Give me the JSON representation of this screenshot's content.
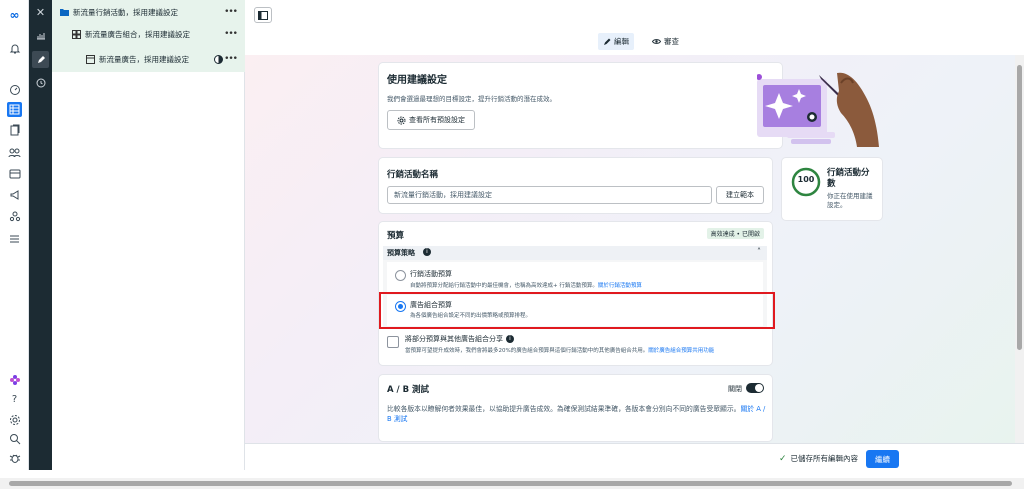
{
  "rail": {
    "icons": [
      "meta-logo-icon",
      "bell-icon",
      "gauge-icon",
      "table-icon",
      "pages-icon",
      "people-icon",
      "card-icon",
      "megaphone-icon",
      "audience-icon",
      "menu-icon",
      "flower-icon",
      "help-icon",
      "settings-icon",
      "search-icon",
      "bug-icon"
    ],
    "help_glyph": "?"
  },
  "tree": {
    "campaign": "新流量行銷活動，採用建議設定",
    "adset": "新流量廣告組合，採用建議設定",
    "ad": "新流量廣告，採用建議設定",
    "more": "•••"
  },
  "header": {
    "edit_label": "編輯",
    "review_label": "審查"
  },
  "recommend": {
    "title": "使用建議設定",
    "desc": "我們會選過最理想的目標設定，提升行銷活動的潛在成效。",
    "button": "查看所有預設設定"
  },
  "campaign_name": {
    "title": "行銷活動名稱",
    "value": "新流量行銷活動，採用建議設定",
    "template_button": "建立範本"
  },
  "score": {
    "value": "100",
    "title": "行銷活動分數",
    "desc": "你正在使用建議設定。"
  },
  "budget": {
    "title": "預算",
    "badge": "高效達成 • 已開啟",
    "strategy_label": "預算策略",
    "option1_title": "行銷活動預算",
    "option1_desc": "自動將預算分配給行銷活動中的最佳機會，也稱為高效達成+ 行銷活動預算。",
    "option1_link": "關於行銷活動預算",
    "option2_title": "廣告組合預算",
    "option2_desc": "為各個廣告組合設定不同的出價策略或預算排程。",
    "share_title": "將部分預算與其他廣告組合分享",
    "share_desc": "當預算可望提升成效時，我們會將最多20%的廣告組合預算與這個行銷活動中的其他廣告組合共用。",
    "share_link": "關於廣告組合預算共用功能"
  },
  "abtest": {
    "title": "A / B 測試",
    "toggle_label": "關閉",
    "desc": "比較各版本以瞭解何者效果最佳，以協助提升廣告成效。為確保測試結果準確，各版本會分別向不同的廣告受眾顯示。",
    "link": "關於 A / B 測試"
  },
  "footer": {
    "saved": "已儲存所有編輯內容",
    "continue": "繼續"
  },
  "colors": {
    "accent": "#1877f2",
    "dark_sidebar": "#1c2b33",
    "highlight": "#e0191f",
    "score_ring": "#2e8540"
  }
}
